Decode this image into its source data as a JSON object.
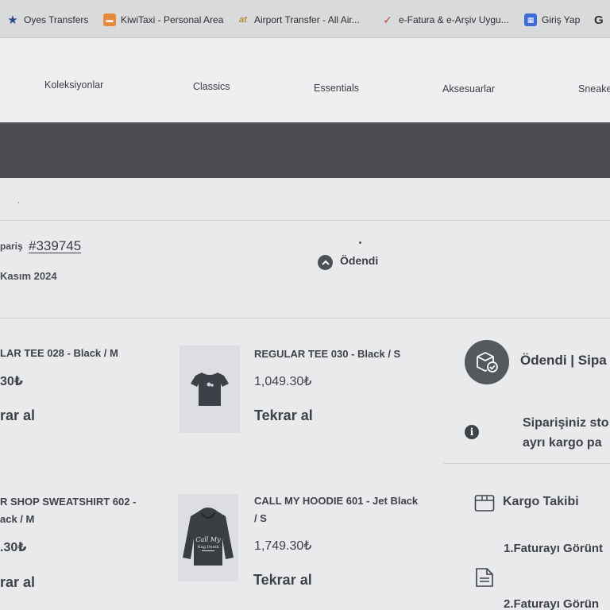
{
  "bookmarks": [
    {
      "label": "Oyes Transfers",
      "icon": "star-icon"
    },
    {
      "label": "KiwiTaxi - Personal Area",
      "icon": "taxi-icon"
    },
    {
      "label": "Airport Transfer - All Air...",
      "icon": "at-icon"
    },
    {
      "label": "e-Fatura & e-Arşiv Uygu...",
      "icon": "checkmark-icon"
    },
    {
      "label": "Giriş Yap",
      "icon": "calendar-icon"
    },
    {
      "label": "G",
      "icon": "google-icon"
    }
  ],
  "nav": {
    "items": [
      "Koleksiyonlar",
      "Classics",
      "Essentials",
      "Aksesuarlar",
      "Sneake"
    ]
  },
  "order": {
    "label": "pariş",
    "number": "#339745",
    "date": "Kasım 2024",
    "status": "Ödendi"
  },
  "products": [
    {
      "name": "LAR TEE 028 - Black / M",
      "price": "30₺",
      "action": "rar al"
    },
    {
      "name": "REGULAR TEE 030 - Black / S",
      "price": "1,049.30₺",
      "action": "Tekrar al"
    },
    {
      "name_lines": [
        "R SHOP SWEATSHIRT 602 -",
        "ack / M"
      ],
      "price": ".30₺",
      "action": "rar al"
    },
    {
      "name_lines": [
        "CALL MY HOODIE 601 - Jet Black",
        "/ S"
      ],
      "price": "1,749.30₺",
      "action": "Tekrar al"
    }
  ],
  "hoodie_print": [
    "Call My",
    "Nag Death"
  ],
  "right_panel": {
    "status": "Ödendi  | Sipa",
    "info_lines": [
      "Siparişiniz sto",
      "ayrı kargo pa"
    ],
    "kargo_title": "Kargo Takibi",
    "links": [
      "1.Faturayı Görünt",
      "2.Faturayı Görün"
    ]
  },
  "colors": {
    "banner": "#4a4c4f",
    "accent_dark": "#55585c",
    "background": "#e9eaec"
  }
}
